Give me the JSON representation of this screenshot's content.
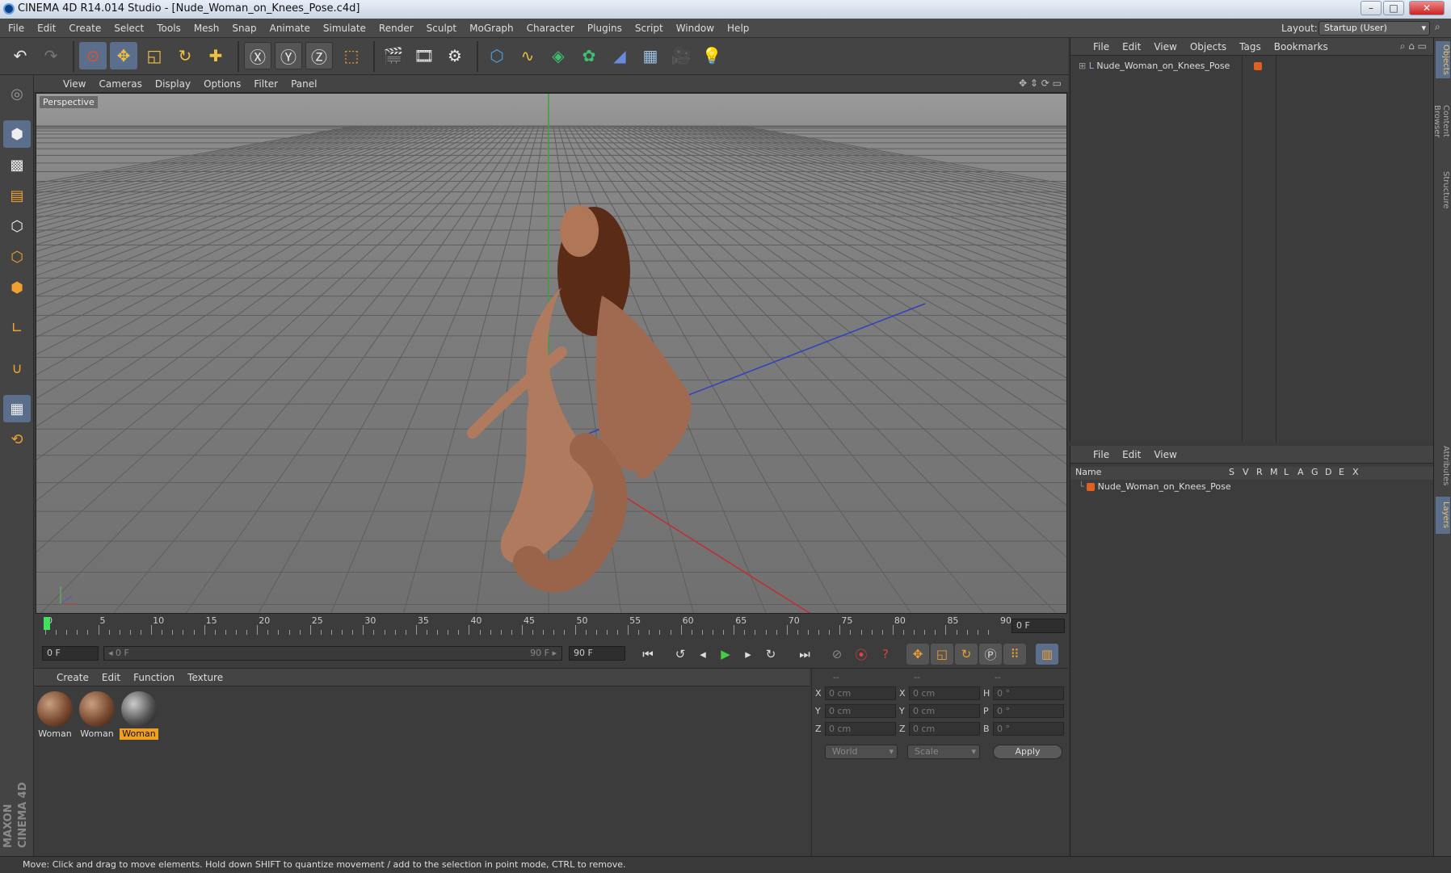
{
  "window": {
    "title": "CINEMA 4D R14.014 Studio - [Nude_Woman_on_Knees_Pose.c4d]",
    "minimize": "–",
    "maximize": "□",
    "close": "✕"
  },
  "menubar": {
    "items": [
      "File",
      "Edit",
      "Create",
      "Select",
      "Tools",
      "Mesh",
      "Snap",
      "Animate",
      "Simulate",
      "Render",
      "Sculpt",
      "MoGraph",
      "Character",
      "Plugins",
      "Script",
      "Window",
      "Help"
    ],
    "layout_label": "Layout:",
    "layout_value": "Startup (User)"
  },
  "viewport": {
    "menu": [
      "View",
      "Cameras",
      "Display",
      "Options",
      "Filter",
      "Panel"
    ],
    "label": "Perspective"
  },
  "timeline": {
    "ticks": [
      "0",
      "5",
      "10",
      "15",
      "20",
      "25",
      "30",
      "35",
      "40",
      "45",
      "50",
      "55",
      "60",
      "65",
      "70",
      "75",
      "80",
      "85",
      "90"
    ],
    "current_frame": "0 F"
  },
  "transport": {
    "start": "0 F",
    "range_start": "◂ 0 F",
    "range_end": "90 F ▸",
    "end": "90 F"
  },
  "material_manager": {
    "menu": [
      "Create",
      "Edit",
      "Function",
      "Texture"
    ],
    "materials": [
      {
        "label": "Woman"
      },
      {
        "label": "Woman"
      },
      {
        "label": "Woman"
      }
    ]
  },
  "coordinates": {
    "headers": [
      "--",
      "--",
      "--"
    ],
    "rows": [
      {
        "a": "X",
        "v1": "0 cm",
        "b": "X",
        "v2": "0 cm",
        "c": "H",
        "v3": "0 °"
      },
      {
        "a": "Y",
        "v1": "0 cm",
        "b": "Y",
        "v2": "0 cm",
        "c": "P",
        "v3": "0 °"
      },
      {
        "a": "Z",
        "v1": "0 cm",
        "b": "Z",
        "v2": "0 cm",
        "c": "B",
        "v3": "0 °"
      }
    ],
    "world": "World",
    "scale": "Scale",
    "apply": "Apply"
  },
  "object_manager": {
    "menu": [
      "File",
      "Edit",
      "View",
      "Objects",
      "Tags",
      "Bookmarks"
    ],
    "object": "Nude_Woman_on_Knees_Pose"
  },
  "layer_manager": {
    "menu": [
      "File",
      "Edit",
      "View"
    ],
    "columns": [
      "Name",
      "S",
      "V",
      "R",
      "M",
      "L",
      "A",
      "G",
      "D",
      "E",
      "X"
    ],
    "layer": "Nude_Woman_on_Knees_Pose"
  },
  "right_tabs": [
    "Objects",
    "Content Browser",
    "Structure",
    "Attributes",
    "Layers"
  ],
  "brand": {
    "line1": "MAXON",
    "line2": "CINEMA 4D"
  },
  "status": "Move: Click and drag to move elements. Hold down SHIFT to quantize movement / add to the selection in point mode, CTRL to remove."
}
